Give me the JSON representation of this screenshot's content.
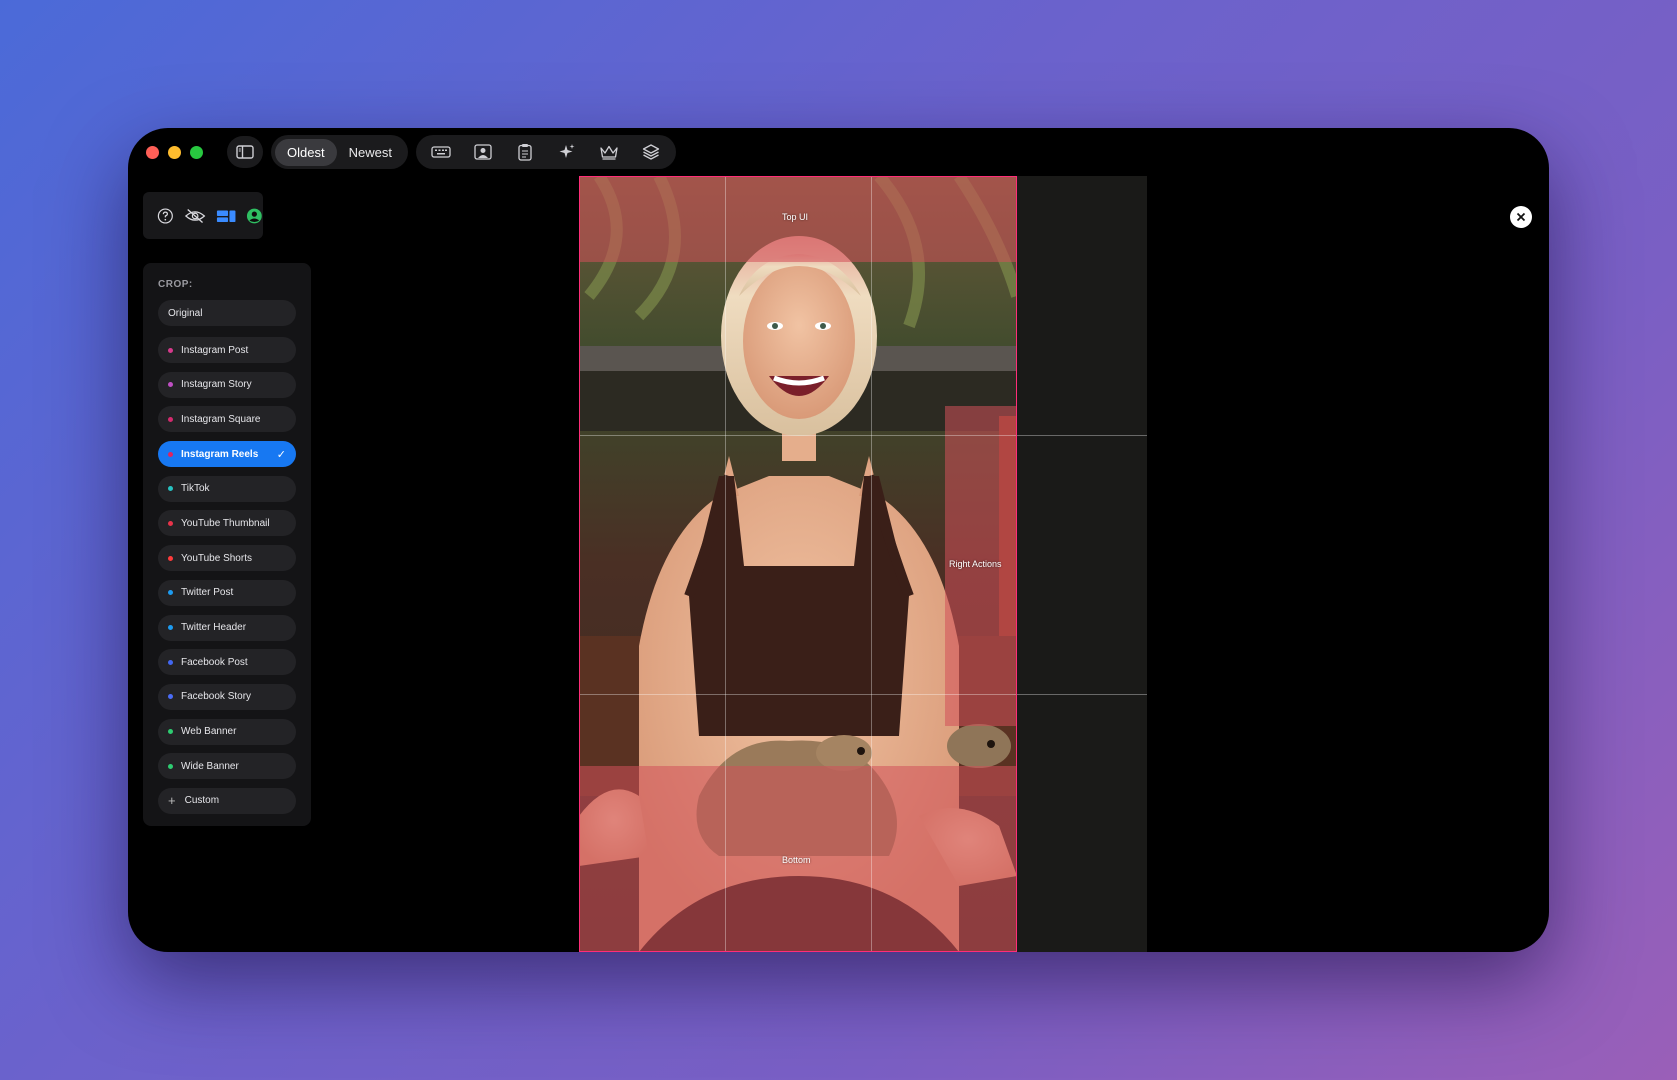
{
  "toolbar": {
    "sort_oldest": "Oldest",
    "sort_newest": "Newest",
    "tools": [
      "keyboard-icon",
      "portrait-icon",
      "clipboard-icon",
      "sparkle-icon",
      "crown-icon",
      "layers-icon"
    ]
  },
  "crop": {
    "title": "CROP:",
    "original": "Original",
    "items": [
      {
        "label": "Instagram Post",
        "color": "#d63a8c"
      },
      {
        "label": "Instagram Story",
        "color": "#c04fc4"
      },
      {
        "label": "Instagram Square",
        "color": "#d42a6e"
      },
      {
        "label": "Instagram Reels",
        "color": "#e0245e",
        "selected": true
      },
      {
        "label": "TikTok",
        "color": "#27c2c2"
      },
      {
        "label": "YouTube Thumbnail",
        "color": "#e8334a"
      },
      {
        "label": "YouTube Shorts",
        "color": "#ff3b3b"
      },
      {
        "label": "Twitter Post",
        "color": "#1d9bf0"
      },
      {
        "label": "Twitter Header",
        "color": "#1d9bf0"
      },
      {
        "label": "Facebook Post",
        "color": "#4267f2"
      },
      {
        "label": "Facebook Story",
        "color": "#4a6cf7"
      },
      {
        "label": "Web Banner",
        "color": "#2ecc71"
      },
      {
        "label": "Wide Banner",
        "color": "#2ecc71"
      }
    ],
    "custom": "Custom",
    "check": "✓"
  },
  "overlay": {
    "top": "Top UI",
    "right": "Right Actions",
    "bottom": "Bottom"
  },
  "colors": {
    "accent": "#1778f2",
    "frame": "#ff2d78"
  }
}
